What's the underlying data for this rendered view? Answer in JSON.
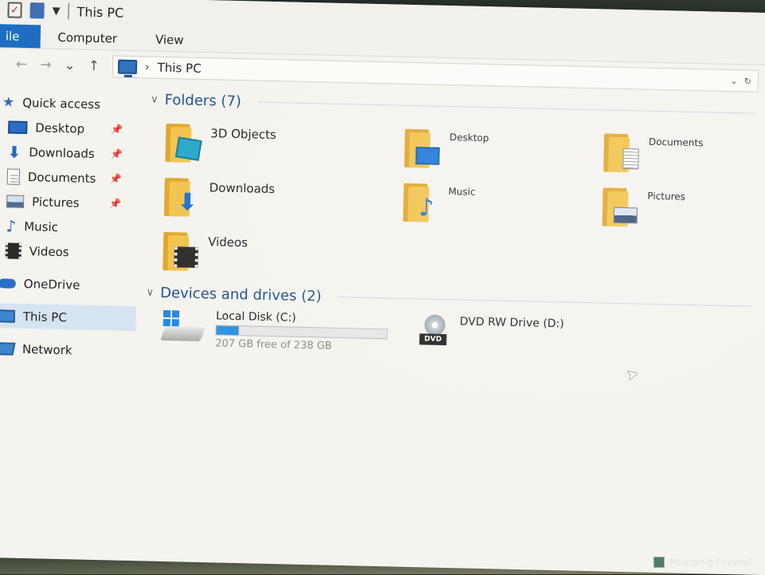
{
  "window": {
    "title": "This PC"
  },
  "ribbon": {
    "tabs": [
      "ile",
      "Computer",
      "View"
    ]
  },
  "address": {
    "back": "←",
    "forward": "→",
    "recent": "⌄",
    "up": "↑",
    "chevron": "›",
    "path": "This PC"
  },
  "sidebar": {
    "quick_access": "Quick access",
    "pinned": [
      {
        "label": "Desktop",
        "icon": "desktop-icon"
      },
      {
        "label": "Downloads",
        "icon": "download-icon"
      },
      {
        "label": "Documents",
        "icon": "documents-icon"
      },
      {
        "label": "Pictures",
        "icon": "pictures-icon"
      }
    ],
    "others": [
      {
        "label": "Music",
        "icon": "music-icon"
      },
      {
        "label": "Videos",
        "icon": "videos-icon"
      }
    ],
    "onedrive": "OneDrive",
    "this_pc": "This PC",
    "network": "Network"
  },
  "folders": {
    "header": "Folders (7)",
    "items": [
      {
        "label": "3D Objects",
        "icon": "3d-objects-icon"
      },
      {
        "label": "Desktop",
        "icon": "desktop-folder-icon"
      },
      {
        "label": "Documents",
        "icon": "documents-folder-icon"
      },
      {
        "label": "Downloads",
        "icon": "downloads-folder-icon"
      },
      {
        "label": "Music",
        "icon": "music-folder-icon"
      },
      {
        "label": "Pictures",
        "icon": "pictures-folder-icon"
      },
      {
        "label": "Videos",
        "icon": "videos-folder-icon"
      }
    ]
  },
  "drives": {
    "header": "Devices and drives (2)",
    "local": {
      "name": "Local Disk (C:)",
      "free": "207 GB free of 238 GB",
      "used_fraction": 0.13
    },
    "dvd": {
      "name": "DVD RW Drive (D:)",
      "badge": "DVD"
    }
  },
  "taskbar": {
    "text": "Mustanig Firewall"
  },
  "colors": {
    "accent": "#1b6ec2",
    "folder": "#f2c34b",
    "usage_fill": "#2a91e0"
  }
}
